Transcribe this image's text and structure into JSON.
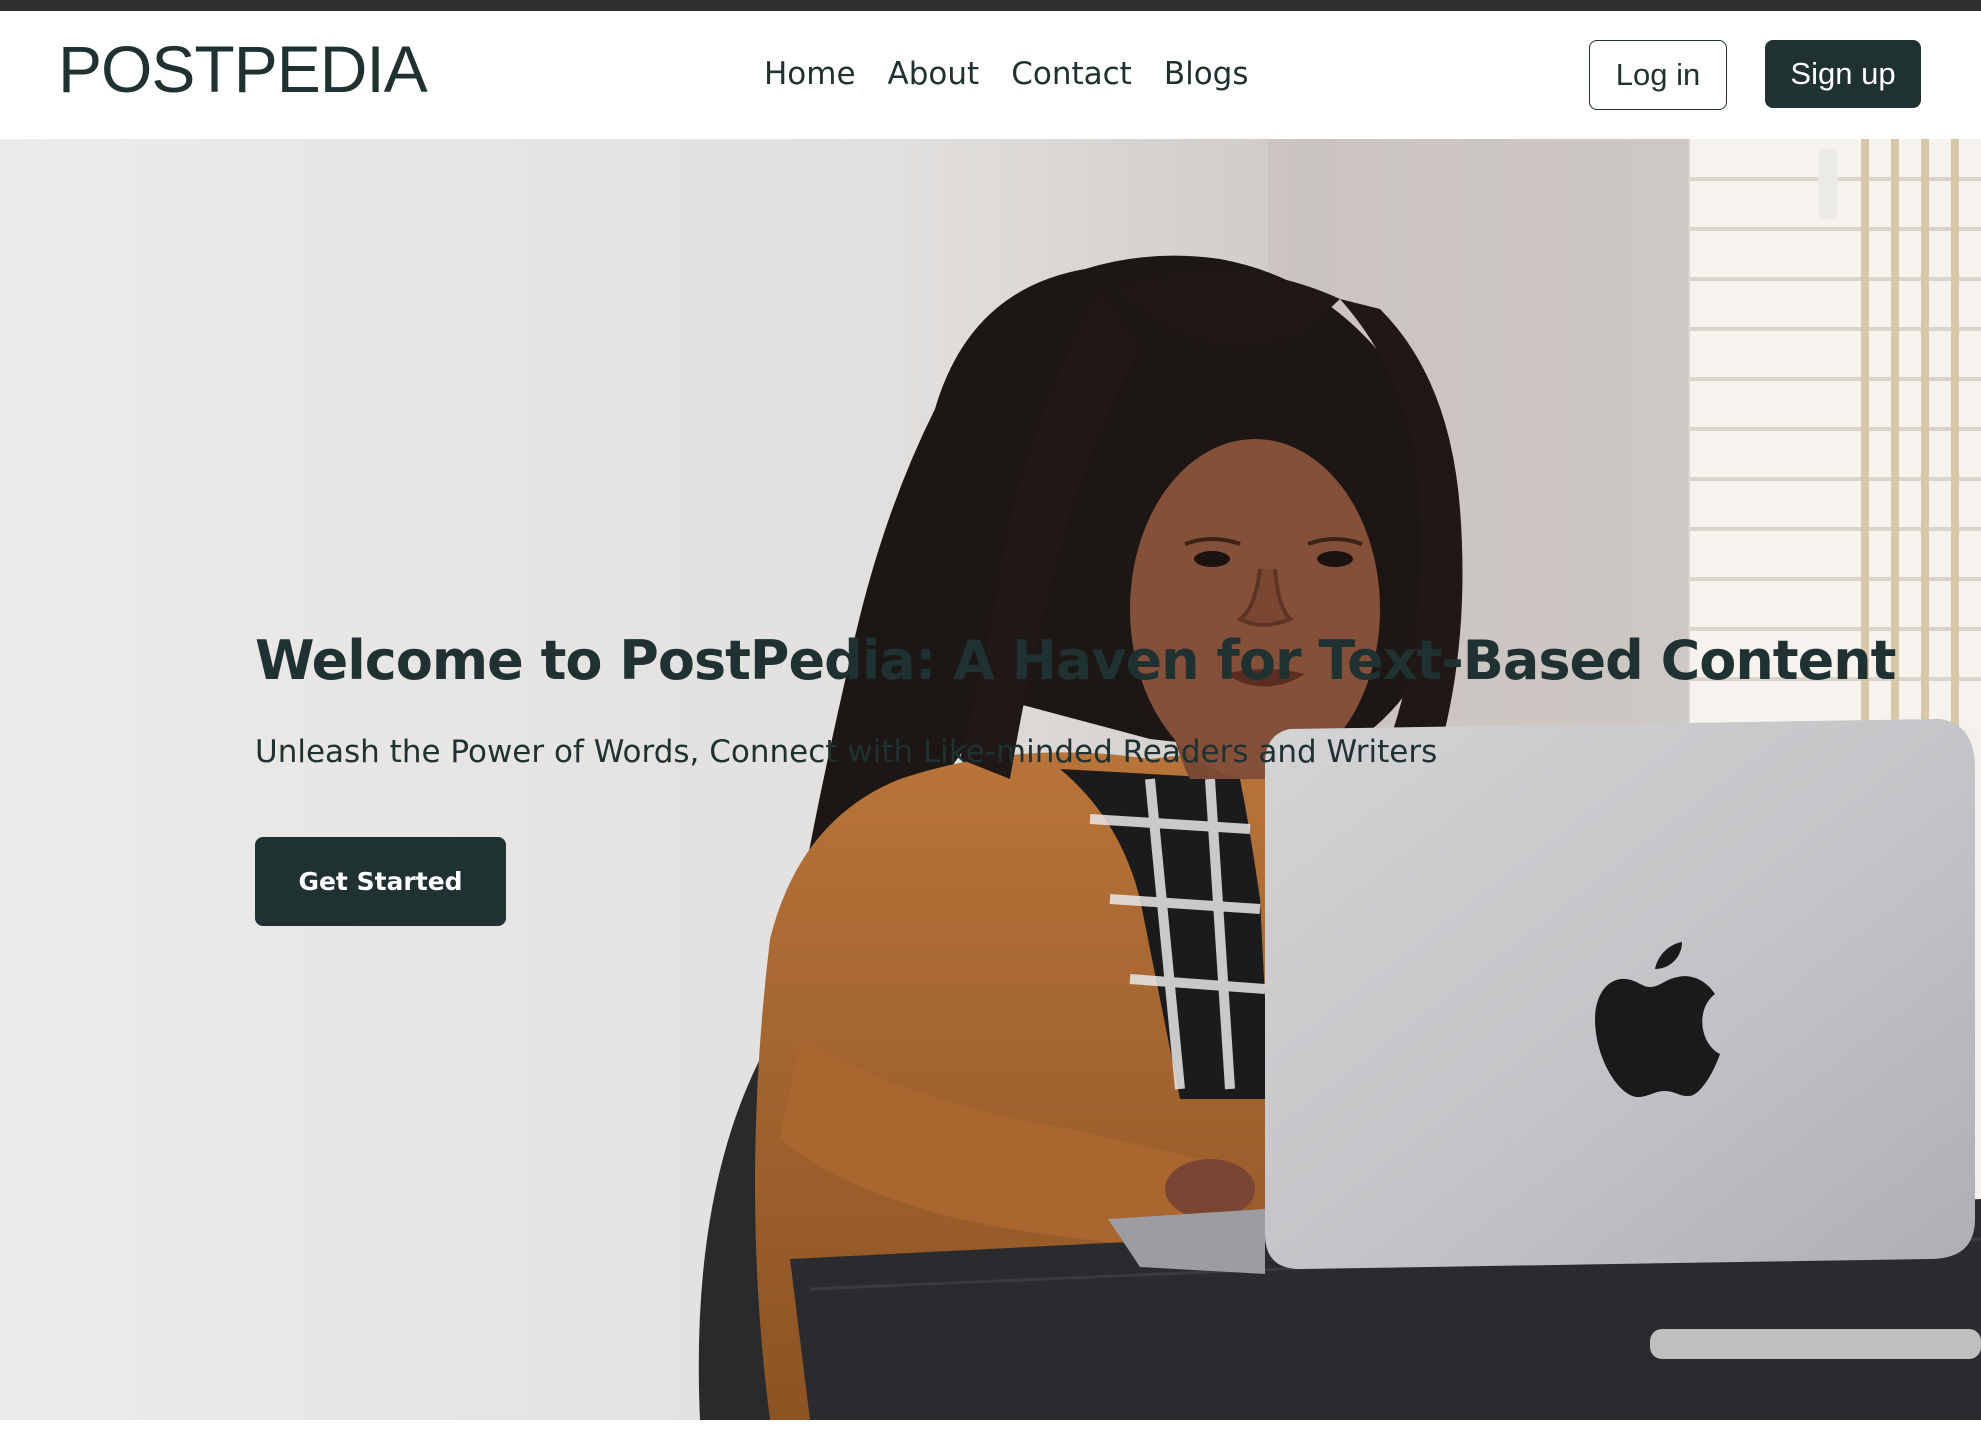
{
  "header": {
    "logo": "POSTPEDIA",
    "nav": [
      {
        "label": "Home"
      },
      {
        "label": "About"
      },
      {
        "label": "Contact"
      },
      {
        "label": "Blogs"
      }
    ],
    "login_label": "Log in",
    "signup_label": "Sign up"
  },
  "hero": {
    "title": "Welcome to PostPedia: A Haven for Text-Based Content",
    "subtitle": "Unleash the Power of Words, Connect with Like-minded Readers and Writers",
    "cta_label": "Get Started",
    "image_icon": "woman-with-laptop-photo"
  },
  "colors": {
    "brand": "#1f3130",
    "background": "#ffffff"
  }
}
